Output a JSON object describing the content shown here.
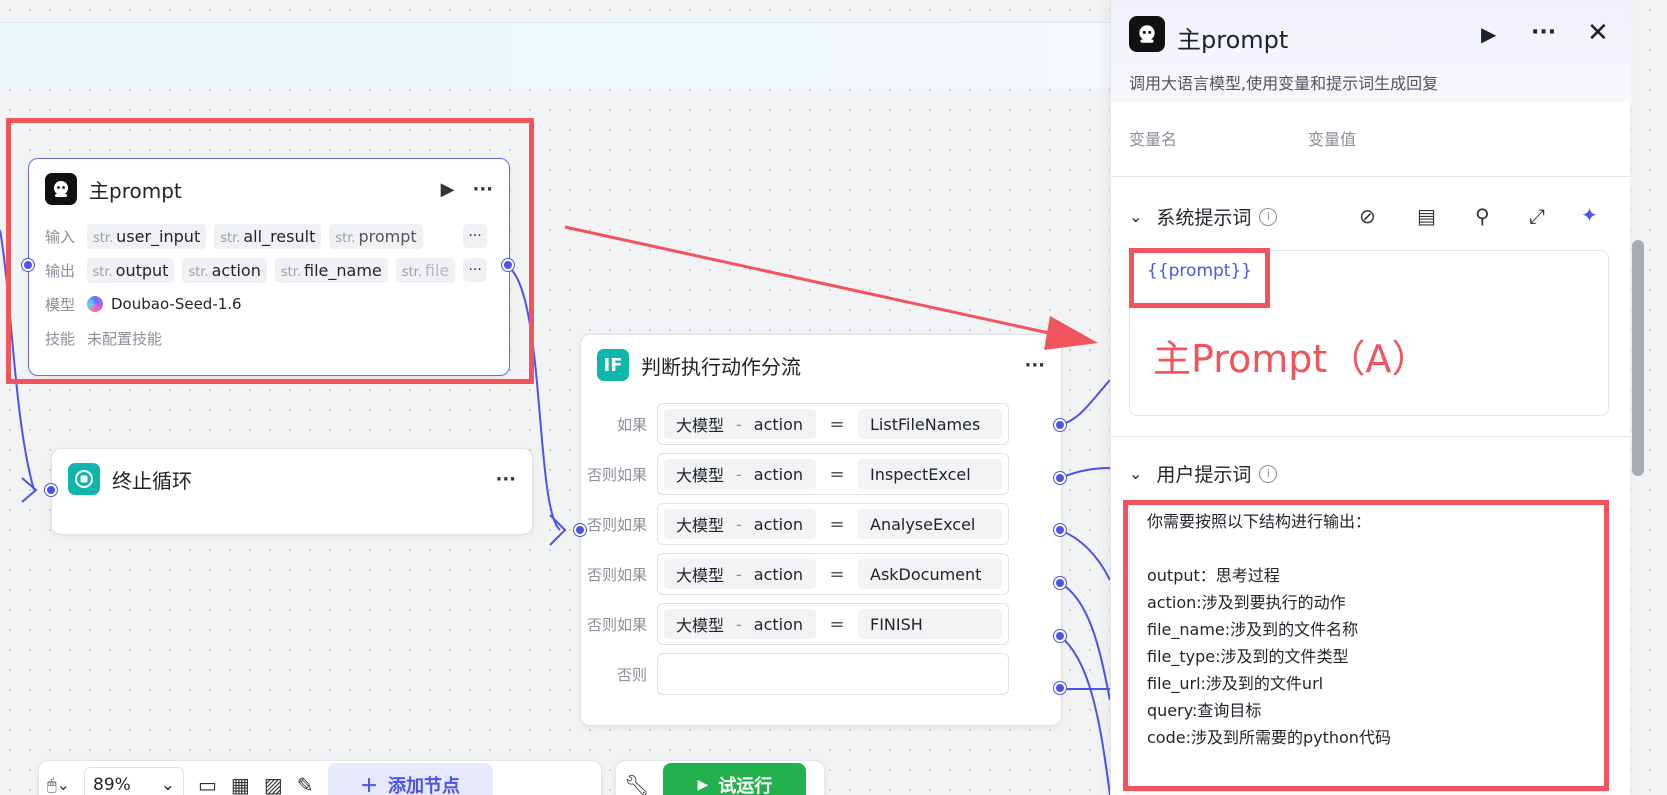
{
  "canvas": {
    "main_node": {
      "title": "主prompt",
      "input_label": "输入",
      "inputs": [
        {
          "type": "str.",
          "name": "user_input"
        },
        {
          "type": "str.",
          "name": "all_result"
        },
        {
          "type": "str.",
          "name": "prompt"
        }
      ],
      "output_label": "输出",
      "outputs": [
        {
          "type": "str.",
          "name": "output"
        },
        {
          "type": "str.",
          "name": "action"
        },
        {
          "type": "str.",
          "name": "file_name"
        },
        {
          "type": "str.",
          "name": "file"
        }
      ],
      "model_label": "模型",
      "model_value": "Doubao-Seed-1.6",
      "skill_label": "技能",
      "skill_value": "未配置技能",
      "more_label": "···"
    },
    "stop_node": {
      "title": "终止循环"
    },
    "branch_node": {
      "icon_text": "IF",
      "title": "判断执行动作分流",
      "rows": [
        {
          "label": "如果",
          "left_source": "大模型",
          "left_var": "action",
          "op": "=",
          "value": "ListFileNames"
        },
        {
          "label": "否则如果",
          "left_source": "大模型",
          "left_var": "action",
          "op": "=",
          "value": "InspectExcel"
        },
        {
          "label": "否则如果",
          "left_source": "大模型",
          "left_var": "action",
          "op": "=",
          "value": "AnalyseExcel"
        },
        {
          "label": "否则如果",
          "left_source": "大模型",
          "left_var": "action",
          "op": "=",
          "value": "AskDocument"
        },
        {
          "label": "否则如果",
          "left_source": "大模型",
          "left_var": "action",
          "op": "=",
          "value": "FINISH"
        }
      ],
      "else_label": "否则"
    }
  },
  "toolbar": {
    "zoom": "89%",
    "add_node_label": "添加节点",
    "run_label": "试运行"
  },
  "panel": {
    "title": "主prompt",
    "subtitle": "调用大语言模型,使用变量和提示词生成回复",
    "var_name_header": "变量名",
    "var_value_header": "变量值",
    "system_prompt": {
      "title": "系统提示词",
      "content": "{{prompt}}",
      "annotation": "主Prompt（A）"
    },
    "user_prompt": {
      "title": "用户提示词",
      "lines": [
        "你需要按照以下结构进行输出：",
        "",
        "output：思考过程",
        "action:涉及到要执行的动作",
        "file_name:涉及到的文件名称",
        "file_type:涉及到的文件类型",
        "file_url:涉及到的文件url",
        "query:查询目标",
        "code:涉及到所需要的python代码"
      ]
    }
  },
  "colors": {
    "accent": "#4d53e8",
    "annotation_red": "#f1545c",
    "run_green": "#23b14d",
    "if_teal": "#0fb5a8"
  }
}
